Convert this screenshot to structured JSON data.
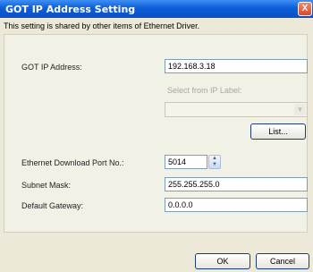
{
  "window": {
    "title": "GOT IP Address Setting",
    "close_glyph": "X"
  },
  "info_text": "This setting is shared by other items of Ethernet Driver.",
  "fields": {
    "got_ip_label": "GOT IP Address:",
    "got_ip_value": "192.168.3.18",
    "ip_label_select": "Select from IP Label:",
    "ip_label_combo_value": "",
    "list_button": "List...",
    "download_port_label": "Ethernet Download Port No.:",
    "download_port_value": "5014",
    "subnet_label": "Subnet Mask:",
    "subnet_value": "255.255.255.0",
    "gateway_label": "Default Gateway:",
    "gateway_value": "0.0.0.0"
  },
  "buttons": {
    "ok": "OK",
    "cancel": "Cancel"
  }
}
